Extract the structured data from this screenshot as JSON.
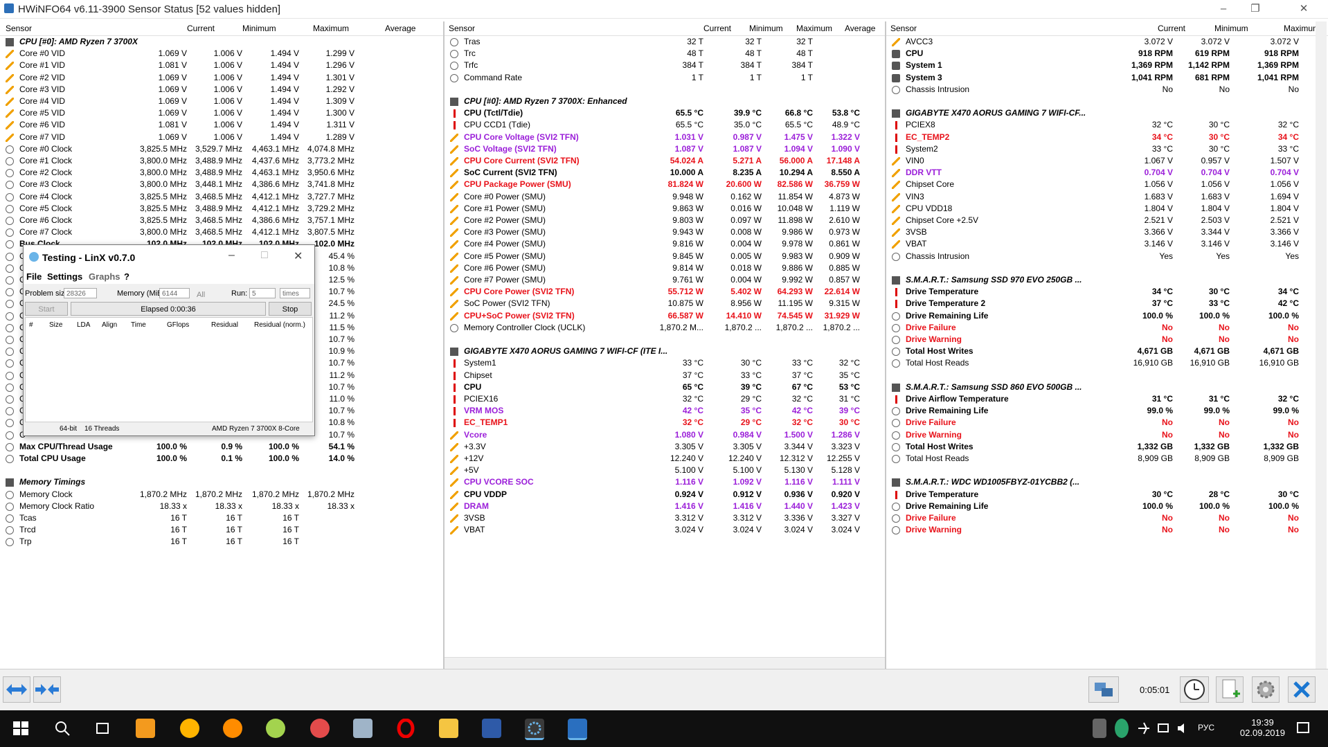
{
  "window": {
    "title": "HWiNFO64 v6.11-3900 Sensor Status [52 values hidden]"
  },
  "headers": {
    "sensor": "Sensor",
    "current": "Current",
    "minimum": "Minimum",
    "maximum": "Maximum",
    "average": "Average"
  },
  "pane1": [
    {
      "n": "CPU [#0]: AMD Ryzen 7 3700X",
      "g": 1
    },
    {
      "n": "Core #0 VID",
      "i": "volt",
      "c": "1.069 V",
      "mi": "1.006 V",
      "ma": "1.494 V",
      "a": "1.299 V"
    },
    {
      "n": "Core #1 VID",
      "i": "volt",
      "c": "1.081 V",
      "mi": "1.006 V",
      "ma": "1.494 V",
      "a": "1.296 V"
    },
    {
      "n": "Core #2 VID",
      "i": "volt",
      "c": "1.069 V",
      "mi": "1.006 V",
      "ma": "1.494 V",
      "a": "1.301 V"
    },
    {
      "n": "Core #3 VID",
      "i": "volt",
      "c": "1.069 V",
      "mi": "1.006 V",
      "ma": "1.494 V",
      "a": "1.292 V"
    },
    {
      "n": "Core #4 VID",
      "i": "volt",
      "c": "1.069 V",
      "mi": "1.006 V",
      "ma": "1.494 V",
      "a": "1.309 V"
    },
    {
      "n": "Core #5 VID",
      "i": "volt",
      "c": "1.069 V",
      "mi": "1.006 V",
      "ma": "1.494 V",
      "a": "1.300 V"
    },
    {
      "n": "Core #6 VID",
      "i": "volt",
      "c": "1.081 V",
      "mi": "1.006 V",
      "ma": "1.494 V",
      "a": "1.311 V"
    },
    {
      "n": "Core #7 VID",
      "i": "volt",
      "c": "1.069 V",
      "mi": "1.006 V",
      "ma": "1.494 V",
      "a": "1.289 V"
    },
    {
      "n": "Core #0 Clock",
      "i": "clock",
      "c": "3,825.5 MHz",
      "mi": "3,529.7 MHz",
      "ma": "4,463.1 MHz",
      "a": "4,074.8 MHz"
    },
    {
      "n": "Core #1 Clock",
      "i": "clock",
      "c": "3,800.0 MHz",
      "mi": "3,488.9 MHz",
      "ma": "4,437.6 MHz",
      "a": "3,773.2 MHz"
    },
    {
      "n": "Core #2 Clock",
      "i": "clock",
      "c": "3,800.0 MHz",
      "mi": "3,488.9 MHz",
      "ma": "4,463.1 MHz",
      "a": "3,950.6 MHz"
    },
    {
      "n": "Core #3 Clock",
      "i": "clock",
      "c": "3,800.0 MHz",
      "mi": "3,448.1 MHz",
      "ma": "4,386.6 MHz",
      "a": "3,741.8 MHz"
    },
    {
      "n": "Core #4 Clock",
      "i": "clock",
      "c": "3,825.5 MHz",
      "mi": "3,468.5 MHz",
      "ma": "4,412.1 MHz",
      "a": "3,727.7 MHz"
    },
    {
      "n": "Core #5 Clock",
      "i": "clock",
      "c": "3,825.5 MHz",
      "mi": "3,488.9 MHz",
      "ma": "4,412.1 MHz",
      "a": "3,729.2 MHz"
    },
    {
      "n": "Core #6 Clock",
      "i": "clock",
      "c": "3,825.5 MHz",
      "mi": "3,468.5 MHz",
      "ma": "4,386.6 MHz",
      "a": "3,757.1 MHz"
    },
    {
      "n": "Core #7 Clock",
      "i": "clock",
      "c": "3,800.0 MHz",
      "mi": "3,468.5 MHz",
      "ma": "4,412.1 MHz",
      "a": "3,807.5 MHz"
    },
    {
      "n": "Bus Clock",
      "i": "clock",
      "c": "102.0 MHz",
      "mi": "102.0 MHz",
      "ma": "102.0 MHz",
      "a": "102.0 MHz",
      "s": "bold"
    },
    {
      "n": "C",
      "i": "clock",
      "a": "45.4 %"
    },
    {
      "n": "C",
      "i": "clock",
      "a": "10.8 %"
    },
    {
      "n": "C",
      "i": "clock",
      "a": "12.5 %"
    },
    {
      "n": "C",
      "i": "clock",
      "a": "10.7 %"
    },
    {
      "n": "C",
      "i": "clock",
      "a": "24.5 %"
    },
    {
      "n": "C",
      "i": "clock",
      "a": "11.2 %"
    },
    {
      "n": "C",
      "i": "clock",
      "a": "11.5 %"
    },
    {
      "n": "C",
      "i": "clock",
      "a": "10.7 %"
    },
    {
      "n": "C",
      "i": "clock",
      "a": "10.9 %"
    },
    {
      "n": "C",
      "i": "clock",
      "a": "10.7 %"
    },
    {
      "n": "C",
      "i": "clock",
      "a": "11.2 %"
    },
    {
      "n": "C",
      "i": "clock",
      "a": "10.7 %"
    },
    {
      "n": "C",
      "i": "clock",
      "a": "11.0 %"
    },
    {
      "n": "C",
      "i": "clock",
      "a": "10.7 %"
    },
    {
      "n": "C",
      "i": "clock",
      "a": "10.8 %"
    },
    {
      "n": "C",
      "i": "clock",
      "a": "10.7 %"
    },
    {
      "n": "Max CPU/Thread Usage",
      "i": "clock",
      "c": "100.0 %",
      "mi": "0.9 %",
      "ma": "100.0 %",
      "a": "54.1 %",
      "s": "bold"
    },
    {
      "n": "Total CPU Usage",
      "i": "clock",
      "c": "100.0 %",
      "mi": "0.1 %",
      "ma": "100.0 %",
      "a": "14.0 %",
      "s": "bold"
    },
    {
      "n": "",
      "e": 1
    },
    {
      "n": "Memory Timings",
      "g": 1
    },
    {
      "n": "Memory Clock",
      "i": "clock",
      "c": "1,870.2 MHz",
      "mi": "1,870.2 MHz",
      "ma": "1,870.2 MHz",
      "a": "1,870.2 MHz"
    },
    {
      "n": "Memory Clock Ratio",
      "i": "clock",
      "c": "18.33 x",
      "mi": "18.33 x",
      "ma": "18.33 x",
      "a": "18.33 x"
    },
    {
      "n": "Tcas",
      "i": "clock",
      "c": "16 T",
      "mi": "16 T",
      "ma": "16 T"
    },
    {
      "n": "Trcd",
      "i": "clock",
      "c": "16 T",
      "mi": "16 T",
      "ma": "16 T"
    },
    {
      "n": "Trp",
      "i": "clock",
      "c": "16 T",
      "mi": "16 T",
      "ma": "16 T"
    }
  ],
  "pane2": [
    {
      "n": "Tras",
      "i": "clock",
      "c": "32 T",
      "mi": "32 T",
      "ma": "32 T"
    },
    {
      "n": "Trc",
      "i": "clock",
      "c": "48 T",
      "mi": "48 T",
      "ma": "48 T"
    },
    {
      "n": "Trfc",
      "i": "clock",
      "c": "384 T",
      "mi": "384 T",
      "ma": "384 T"
    },
    {
      "n": "Command Rate",
      "i": "clock",
      "c": "1 T",
      "mi": "1 T",
      "ma": "1 T"
    },
    {
      "n": "",
      "e": 1
    },
    {
      "n": "CPU [#0]: AMD Ryzen 7 3700X: Enhanced",
      "g": 1
    },
    {
      "n": "CPU (Tctl/Tdie)",
      "i": "therm",
      "c": "65.5 °C",
      "mi": "39.9 °C",
      "ma": "66.8 °C",
      "a": "53.8 °C",
      "s": "bold"
    },
    {
      "n": "CPU CCD1 (Tdie)",
      "i": "therm",
      "c": "65.5 °C",
      "mi": "35.0 °C",
      "ma": "65.5 °C",
      "a": "48.9 °C"
    },
    {
      "n": "CPU Core Voltage (SVI2 TFN)",
      "i": "volt",
      "c": "1.031 V",
      "mi": "0.987 V",
      "ma": "1.475 V",
      "a": "1.322 V",
      "s": "purple"
    },
    {
      "n": "SoC Voltage (SVI2 TFN)",
      "i": "volt",
      "c": "1.087 V",
      "mi": "1.087 V",
      "ma": "1.094 V",
      "a": "1.090 V",
      "s": "purple"
    },
    {
      "n": "CPU Core Current (SVI2 TFN)",
      "i": "volt",
      "c": "54.024 A",
      "mi": "5.271 A",
      "ma": "56.000 A",
      "a": "17.148 A",
      "s": "red"
    },
    {
      "n": "SoC Current (SVI2 TFN)",
      "i": "volt",
      "c": "10.000 A",
      "mi": "8.235 A",
      "ma": "10.294 A",
      "a": "8.550 A",
      "s": "bold"
    },
    {
      "n": "CPU Package Power (SMU)",
      "i": "volt",
      "c": "81.824 W",
      "mi": "20.600 W",
      "ma": "82.586 W",
      "a": "36.759 W",
      "s": "red"
    },
    {
      "n": "Core #0 Power (SMU)",
      "i": "volt",
      "c": "9.948 W",
      "mi": "0.162 W",
      "ma": "11.854 W",
      "a": "4.873 W"
    },
    {
      "n": "Core #1 Power (SMU)",
      "i": "volt",
      "c": "9.863 W",
      "mi": "0.016 W",
      "ma": "10.048 W",
      "a": "1.119 W"
    },
    {
      "n": "Core #2 Power (SMU)",
      "i": "volt",
      "c": "9.803 W",
      "mi": "0.097 W",
      "ma": "11.898 W",
      "a": "2.610 W"
    },
    {
      "n": "Core #3 Power (SMU)",
      "i": "volt",
      "c": "9.943 W",
      "mi": "0.008 W",
      "ma": "9.986 W",
      "a": "0.973 W"
    },
    {
      "n": "Core #4 Power (SMU)",
      "i": "volt",
      "c": "9.816 W",
      "mi": "0.004 W",
      "ma": "9.978 W",
      "a": "0.861 W"
    },
    {
      "n": "Core #5 Power (SMU)",
      "i": "volt",
      "c": "9.845 W",
      "mi": "0.005 W",
      "ma": "9.983 W",
      "a": "0.909 W"
    },
    {
      "n": "Core #6 Power (SMU)",
      "i": "volt",
      "c": "9.814 W",
      "mi": "0.018 W",
      "ma": "9.886 W",
      "a": "0.885 W"
    },
    {
      "n": "Core #7 Power (SMU)",
      "i": "volt",
      "c": "9.761 W",
      "mi": "0.004 W",
      "ma": "9.992 W",
      "a": "0.857 W"
    },
    {
      "n": "CPU Core Power (SVI2 TFN)",
      "i": "volt",
      "c": "55.712 W",
      "mi": "5.402 W",
      "ma": "64.293 W",
      "a": "22.614 W",
      "s": "red"
    },
    {
      "n": "SoC Power (SVI2 TFN)",
      "i": "volt",
      "c": "10.875 W",
      "mi": "8.956 W",
      "ma": "11.195 W",
      "a": "9.315 W"
    },
    {
      "n": "CPU+SoC Power (SVI2 TFN)",
      "i": "volt",
      "c": "66.587 W",
      "mi": "14.410 W",
      "ma": "74.545 W",
      "a": "31.929 W",
      "s": "red"
    },
    {
      "n": "Memory Controller Clock (UCLK)",
      "i": "clock",
      "c": "1,870.2 M...",
      "mi": "1,870.2 ...",
      "ma": "1,870.2 ...",
      "a": "1,870.2 ..."
    },
    {
      "n": "",
      "e": 1
    },
    {
      "n": "GIGABYTE X470 AORUS GAMING 7 WIFI-CF (ITE I...",
      "g": 1
    },
    {
      "n": "System1",
      "i": "therm",
      "c": "33 °C",
      "mi": "30 °C",
      "ma": "33 °C",
      "a": "32 °C"
    },
    {
      "n": "Chipset",
      "i": "therm",
      "c": "37 °C",
      "mi": "33 °C",
      "ma": "37 °C",
      "a": "35 °C"
    },
    {
      "n": "CPU",
      "i": "therm",
      "c": "65 °C",
      "mi": "39 °C",
      "ma": "67 °C",
      "a": "53 °C",
      "s": "bold"
    },
    {
      "n": "PCIEX16",
      "i": "therm",
      "c": "32 °C",
      "mi": "29 °C",
      "ma": "32 °C",
      "a": "31 °C"
    },
    {
      "n": "VRM MOS",
      "i": "therm",
      "c": "42 °C",
      "mi": "35 °C",
      "ma": "42 °C",
      "a": "39 °C",
      "s": "purple"
    },
    {
      "n": "EC_TEMP1",
      "i": "therm",
      "c": "32 °C",
      "mi": "29 °C",
      "ma": "32 °C",
      "a": "30 °C",
      "s": "red"
    },
    {
      "n": "Vcore",
      "i": "volt",
      "c": "1.080 V",
      "mi": "0.984 V",
      "ma": "1.500 V",
      "a": "1.286 V",
      "s": "purple"
    },
    {
      "n": "+3.3V",
      "i": "volt",
      "c": "3.305 V",
      "mi": "3.305 V",
      "ma": "3.344 V",
      "a": "3.323 V"
    },
    {
      "n": "+12V",
      "i": "volt",
      "c": "12.240 V",
      "mi": "12.240 V",
      "ma": "12.312 V",
      "a": "12.255 V"
    },
    {
      "n": "+5V",
      "i": "volt",
      "c": "5.100 V",
      "mi": "5.100 V",
      "ma": "5.130 V",
      "a": "5.128 V"
    },
    {
      "n": "CPU VCORE SOC",
      "i": "volt",
      "c": "1.116 V",
      "mi": "1.092 V",
      "ma": "1.116 V",
      "a": "1.111 V",
      "s": "purple"
    },
    {
      "n": "CPU VDDP",
      "i": "volt",
      "c": "0.924 V",
      "mi": "0.912 V",
      "ma": "0.936 V",
      "a": "0.920 V",
      "s": "bold"
    },
    {
      "n": "DRAM",
      "i": "volt",
      "c": "1.416 V",
      "mi": "1.416 V",
      "ma": "1.440 V",
      "a": "1.423 V",
      "s": "purple"
    },
    {
      "n": "3VSB",
      "i": "volt",
      "c": "3.312 V",
      "mi": "3.312 V",
      "ma": "3.336 V",
      "a": "3.327 V"
    },
    {
      "n": "VBAT",
      "i": "volt",
      "c": "3.024 V",
      "mi": "3.024 V",
      "ma": "3.024 V",
      "a": "3.024 V"
    }
  ],
  "pane3": [
    {
      "n": "AVCC3",
      "i": "volt",
      "c": "3.072 V",
      "mi": "3.072 V",
      "ma": "3.072 V"
    },
    {
      "n": "CPU",
      "i": "fan",
      "c": "918 RPM",
      "mi": "619 RPM",
      "ma": "918 RPM",
      "s": "bold"
    },
    {
      "n": "System 1",
      "i": "fan",
      "c": "1,369 RPM",
      "mi": "1,142 RPM",
      "ma": "1,369 RPM",
      "s": "bold"
    },
    {
      "n": "System 3",
      "i": "fan",
      "c": "1,041 RPM",
      "mi": "681 RPM",
      "ma": "1,041 RPM",
      "s": "bold"
    },
    {
      "n": "Chassis Intrusion",
      "i": "clock",
      "c": "No",
      "mi": "No",
      "ma": "No"
    },
    {
      "n": "",
      "e": 1
    },
    {
      "n": "GIGABYTE X470 AORUS GAMING 7 WIFI-CF...",
      "g": 1
    },
    {
      "n": "PCIEX8",
      "i": "therm",
      "c": "32 °C",
      "mi": "30 °C",
      "ma": "32 °C"
    },
    {
      "n": "EC_TEMP2",
      "i": "therm",
      "c": "34 °C",
      "mi": "30 °C",
      "ma": "34 °C",
      "s": "red"
    },
    {
      "n": "System2",
      "i": "therm",
      "c": "33 °C",
      "mi": "30 °C",
      "ma": "33 °C"
    },
    {
      "n": "VIN0",
      "i": "volt",
      "c": "1.067 V",
      "mi": "0.957 V",
      "ma": "1.507 V"
    },
    {
      "n": "DDR VTT",
      "i": "volt",
      "c": "0.704 V",
      "mi": "0.704 V",
      "ma": "0.704 V",
      "s": "purple"
    },
    {
      "n": "Chipset Core",
      "i": "volt",
      "c": "1.056 V",
      "mi": "1.056 V",
      "ma": "1.056 V"
    },
    {
      "n": "VIN3",
      "i": "volt",
      "c": "1.683 V",
      "mi": "1.683 V",
      "ma": "1.694 V"
    },
    {
      "n": "CPU VDD18",
      "i": "volt",
      "c": "1.804 V",
      "mi": "1.804 V",
      "ma": "1.804 V"
    },
    {
      "n": "Chipset Core +2.5V",
      "i": "volt",
      "c": "2.521 V",
      "mi": "2.503 V",
      "ma": "2.521 V"
    },
    {
      "n": "3VSB",
      "i": "volt",
      "c": "3.366 V",
      "mi": "3.344 V",
      "ma": "3.366 V"
    },
    {
      "n": "VBAT",
      "i": "volt",
      "c": "3.146 V",
      "mi": "3.146 V",
      "ma": "3.146 V"
    },
    {
      "n": "Chassis Intrusion",
      "i": "clock",
      "c": "Yes",
      "mi": "Yes",
      "ma": "Yes"
    },
    {
      "n": "",
      "e": 1
    },
    {
      "n": "S.M.A.R.T.: Samsung SSD 970 EVO 250GB ...",
      "g": 1
    },
    {
      "n": "Drive Temperature",
      "i": "therm",
      "c": "34 °C",
      "mi": "30 °C",
      "ma": "34 °C",
      "s": "bold"
    },
    {
      "n": "Drive Temperature 2",
      "i": "therm",
      "c": "37 °C",
      "mi": "33 °C",
      "ma": "42 °C",
      "s": "bold"
    },
    {
      "n": "Drive Remaining Life",
      "i": "clock",
      "c": "100.0 %",
      "mi": "100.0 %",
      "ma": "100.0 %",
      "s": "bold"
    },
    {
      "n": "Drive Failure",
      "i": "clock",
      "c": "No",
      "mi": "No",
      "ma": "No",
      "s": "red"
    },
    {
      "n": "Drive Warning",
      "i": "clock",
      "c": "No",
      "mi": "No",
      "ma": "No",
      "s": "red"
    },
    {
      "n": "Total Host Writes",
      "i": "clock",
      "c": "4,671 GB",
      "mi": "4,671 GB",
      "ma": "4,671 GB",
      "s": "bold"
    },
    {
      "n": "Total Host Reads",
      "i": "clock",
      "c": "16,910 GB",
      "mi": "16,910 GB",
      "ma": "16,910 GB"
    },
    {
      "n": "",
      "e": 1
    },
    {
      "n": "S.M.A.R.T.: Samsung SSD 860 EVO 500GB ...",
      "g": 1
    },
    {
      "n": "Drive Airflow Temperature",
      "i": "therm",
      "c": "31 °C",
      "mi": "31 °C",
      "ma": "32 °C",
      "s": "bold"
    },
    {
      "n": "Drive Remaining Life",
      "i": "clock",
      "c": "99.0 %",
      "mi": "99.0 %",
      "ma": "99.0 %",
      "s": "bold"
    },
    {
      "n": "Drive Failure",
      "i": "clock",
      "c": "No",
      "mi": "No",
      "ma": "No",
      "s": "red"
    },
    {
      "n": "Drive Warning",
      "i": "clock",
      "c": "No",
      "mi": "No",
      "ma": "No",
      "s": "red"
    },
    {
      "n": "Total Host Writes",
      "i": "clock",
      "c": "1,332 GB",
      "mi": "1,332 GB",
      "ma": "1,332 GB",
      "s": "bold"
    },
    {
      "n": "Total Host Reads",
      "i": "clock",
      "c": "8,909 GB",
      "mi": "8,909 GB",
      "ma": "8,909 GB"
    },
    {
      "n": "",
      "e": 1
    },
    {
      "n": "S.M.A.R.T.: WDC WD1005FBYZ-01YCBB2 (...",
      "g": 1
    },
    {
      "n": "Drive Temperature",
      "i": "therm",
      "c": "30 °C",
      "mi": "28 °C",
      "ma": "30 °C",
      "s": "bold"
    },
    {
      "n": "Drive Remaining Life",
      "i": "clock",
      "c": "100.0 %",
      "mi": "100.0 %",
      "ma": "100.0 %",
      "s": "bold"
    },
    {
      "n": "Drive Failure",
      "i": "clock",
      "c": "No",
      "mi": "No",
      "ma": "No",
      "s": "red"
    },
    {
      "n": "Drive Warning",
      "i": "clock",
      "c": "No",
      "mi": "No",
      "ma": "No",
      "s": "red"
    }
  ],
  "linx": {
    "title": "Testing - LinX v0.7.0",
    "menu": {
      "file": "File",
      "settings": "Settings",
      "graphs": "Graphs",
      "help": "?"
    },
    "problem_size_label": "Problem size:",
    "problem_size_value": "28326",
    "memory_label": "Memory (MiB):",
    "memory_value": "6144",
    "all_label": "All",
    "run_label": "Run:",
    "run_value": "5",
    "run_unit": "times",
    "start": "Start",
    "elapsed": "Elapsed 0:00:36",
    "stop": "Stop",
    "columns": [
      "#",
      "Size",
      "LDA",
      "Align",
      "Time",
      "GFlops",
      "Residual",
      "Residual (norm.)"
    ],
    "status": {
      "bits": "64-bit",
      "threads": "16 Threads",
      "cpu": "AMD Ryzen 7 3700X 8-Core"
    }
  },
  "toolbar": {
    "elapsed": "0:05:01"
  },
  "taskbar": {
    "lang": "РУС",
    "time": "19:39",
    "date": "02.09.2019"
  },
  "colors": {
    "purple": "#9b1fd9",
    "red": "#e8121a",
    "volt_icon": "#f0a000"
  }
}
